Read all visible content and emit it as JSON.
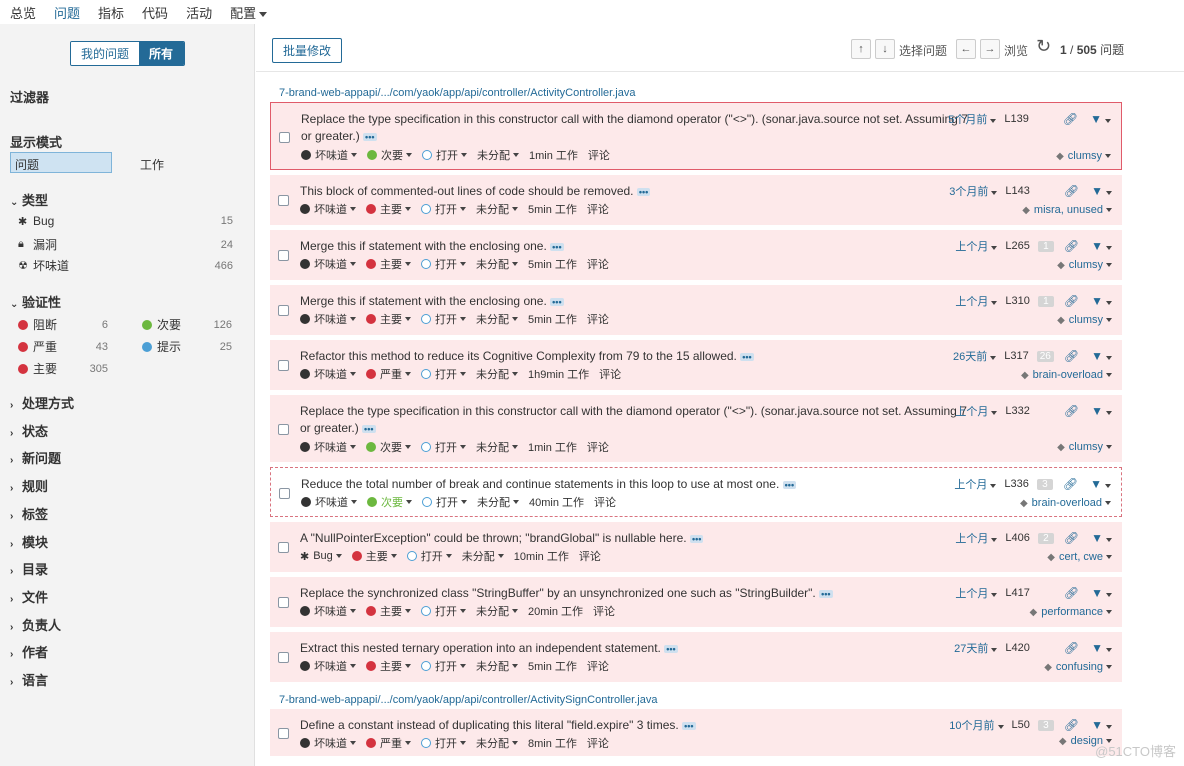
{
  "topnav": [
    "总览",
    "问题",
    "指标",
    "代码",
    "活动",
    "配置"
  ],
  "sidebar": {
    "seg_my": "我的问题",
    "seg_all": "所有",
    "filters_title": "过滤器",
    "mode_title": "显示模式",
    "mode_issues": "问题",
    "mode_work": "工作",
    "type_head": "类型",
    "types": [
      {
        "label": "Bug",
        "count": "15"
      },
      {
        "label": "漏洞",
        "count": "24"
      },
      {
        "label": "坏味道",
        "count": "466"
      }
    ],
    "severity_head": "验证性",
    "severities": [
      {
        "label": "阻断",
        "count": "6"
      },
      {
        "label": "次要",
        "count": "126"
      },
      {
        "label": "严重",
        "count": "43"
      },
      {
        "label": "提示",
        "count": "25"
      },
      {
        "label": "主要",
        "count": "305"
      }
    ],
    "collapsed": [
      "处理方式",
      "状态",
      "新问题",
      "规则",
      "标签",
      "模块",
      "目录",
      "文件",
      "负责人",
      "作者",
      "语言"
    ]
  },
  "toolbar": {
    "bulk": "批量修改",
    "up": "↑",
    "down": "↓",
    "select_issue": "选择问题",
    "left": "←",
    "right": "→",
    "browse": "浏览",
    "page_current": "1",
    "page_total": "505",
    "page_label": "问题"
  },
  "file1": "7-brand-web-appapi/.../com/yaok/app/api/controller/ActivityController.java",
  "file2": "7-brand-web-appapi/.../com/yaok/app/api/controller/ActivitySignController.java",
  "issues": [
    {
      "msg": "Replace the type specification in this constructor call with the diamond operator (\"<>\"). (sonar.java.source not set. Assuming 7 or greater.)",
      "type": "坏味道",
      "sev": "次要",
      "status": "打开",
      "assignee": "未分配",
      "effort": "1min 工作",
      "comment": "评论",
      "age": "5个月前",
      "line": "L139",
      "badge": "",
      "tags": "clumsy"
    },
    {
      "msg": "This block of commented-out lines of code should be removed.",
      "type": "坏味道",
      "sev": "主要",
      "status": "打开",
      "assignee": "未分配",
      "effort": "5min 工作",
      "comment": "评论",
      "age": "3个月前",
      "line": "L143",
      "badge": "",
      "tags": "misra, unused"
    },
    {
      "msg": "Merge this if statement with the enclosing one.",
      "type": "坏味道",
      "sev": "主要",
      "status": "打开",
      "assignee": "未分配",
      "effort": "5min 工作",
      "comment": "评论",
      "age": "上个月",
      "line": "L265",
      "badge": "1",
      "tags": "clumsy"
    },
    {
      "msg": "Merge this if statement with the enclosing one.",
      "type": "坏味道",
      "sev": "主要",
      "status": "打开",
      "assignee": "未分配",
      "effort": "5min 工作",
      "comment": "评论",
      "age": "上个月",
      "line": "L310",
      "badge": "1",
      "tags": "clumsy"
    },
    {
      "msg": "Refactor this method to reduce its Cognitive Complexity from 79 to the 15 allowed.",
      "type": "坏味道",
      "sev": "严重",
      "status": "打开",
      "assignee": "未分配",
      "effort": "1h9min 工作",
      "comment": "评论",
      "age": "26天前",
      "line": "L317",
      "badge": "26",
      "tags": "brain-overload"
    },
    {
      "msg": "Replace the type specification in this constructor call with the diamond operator (\"<>\"). (sonar.java.source not set. Assuming 7 or greater.)",
      "type": "坏味道",
      "sev": "次要",
      "status": "打开",
      "assignee": "未分配",
      "effort": "1min 工作",
      "comment": "评论",
      "age": "上个月",
      "line": "L332",
      "badge": "",
      "tags": "clumsy"
    },
    {
      "msg": "Reduce the total number of break and continue statements in this loop to use at most one.",
      "type": "坏味道",
      "sev": "次要",
      "status": "打开",
      "assignee": "未分配",
      "effort": "40min 工作",
      "comment": "评论",
      "age": "上个月",
      "line": "L336",
      "badge": "3",
      "tags": "brain-overload"
    },
    {
      "msg": "A \"NullPointerException\" could be thrown; \"brandGlobal\" is nullable here.",
      "type": "Bug",
      "sev": "主要",
      "status": "打开",
      "assignee": "未分配",
      "effort": "10min 工作",
      "comment": "评论",
      "age": "上个月",
      "line": "L406",
      "badge": "2",
      "tags": "cert, cwe"
    },
    {
      "msg": "Replace the synchronized class \"StringBuffer\" by an unsynchronized one such as \"StringBuilder\".",
      "type": "坏味道",
      "sev": "主要",
      "status": "打开",
      "assignee": "未分配",
      "effort": "20min 工作",
      "comment": "评论",
      "age": "上个月",
      "line": "L417",
      "badge": "",
      "tags": "performance"
    },
    {
      "msg": "Extract this nested ternary operation into an independent statement.",
      "type": "坏味道",
      "sev": "主要",
      "status": "打开",
      "assignee": "未分配",
      "effort": "5min 工作",
      "comment": "评论",
      "age": "27天前",
      "line": "L420",
      "badge": "",
      "tags": "confusing"
    },
    {
      "msg": "Define a constant instead of duplicating this literal \"field.expire\" 3 times.",
      "type": "坏味道",
      "sev": "严重",
      "status": "打开",
      "assignee": "未分配",
      "effort": "8min 工作",
      "comment": "评论",
      "age": "10个月前",
      "line": "L50",
      "badge": "3",
      "tags": "design"
    }
  ],
  "watermark": "@51CTO博客"
}
